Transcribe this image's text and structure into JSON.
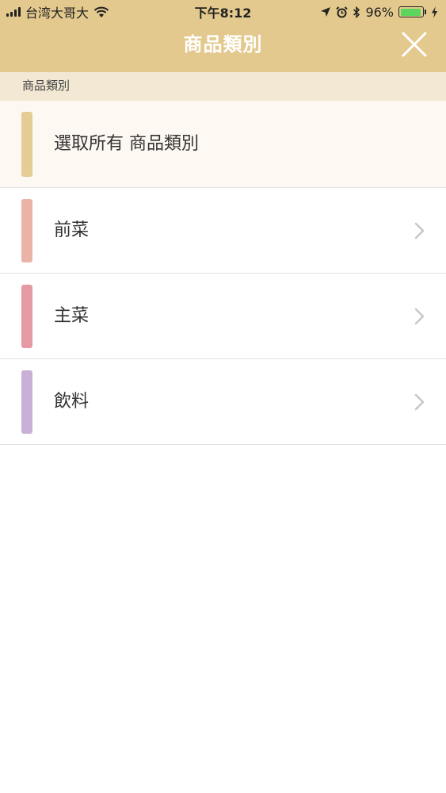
{
  "status_bar": {
    "carrier": "台湾大哥大",
    "time": "下午8:12",
    "battery_percent": "96%",
    "battery_level": 0.96,
    "icons": [
      "signal-icon",
      "wifi-icon",
      "location-icon",
      "alarm-icon",
      "bluetooth-icon",
      "battery-icon",
      "charging-icon"
    ]
  },
  "nav": {
    "title": "商品類別",
    "close_icon": "close-icon"
  },
  "section": {
    "header": "商品類別"
  },
  "categories": [
    {
      "label": "選取所有 商品類別",
      "color": "#e5cc94",
      "has_chevron": false
    },
    {
      "label": "前菜",
      "color": "#ebb3a8",
      "has_chevron": true
    },
    {
      "label": "主菜",
      "color": "#e59aa3",
      "has_chevron": true
    },
    {
      "label": "飲料",
      "color": "#c9b0d6",
      "has_chevron": true
    }
  ],
  "colors": {
    "header_bg": "#e3c98d",
    "section_bg": "#f3e8d3",
    "chevron": "#c7c7cc"
  }
}
